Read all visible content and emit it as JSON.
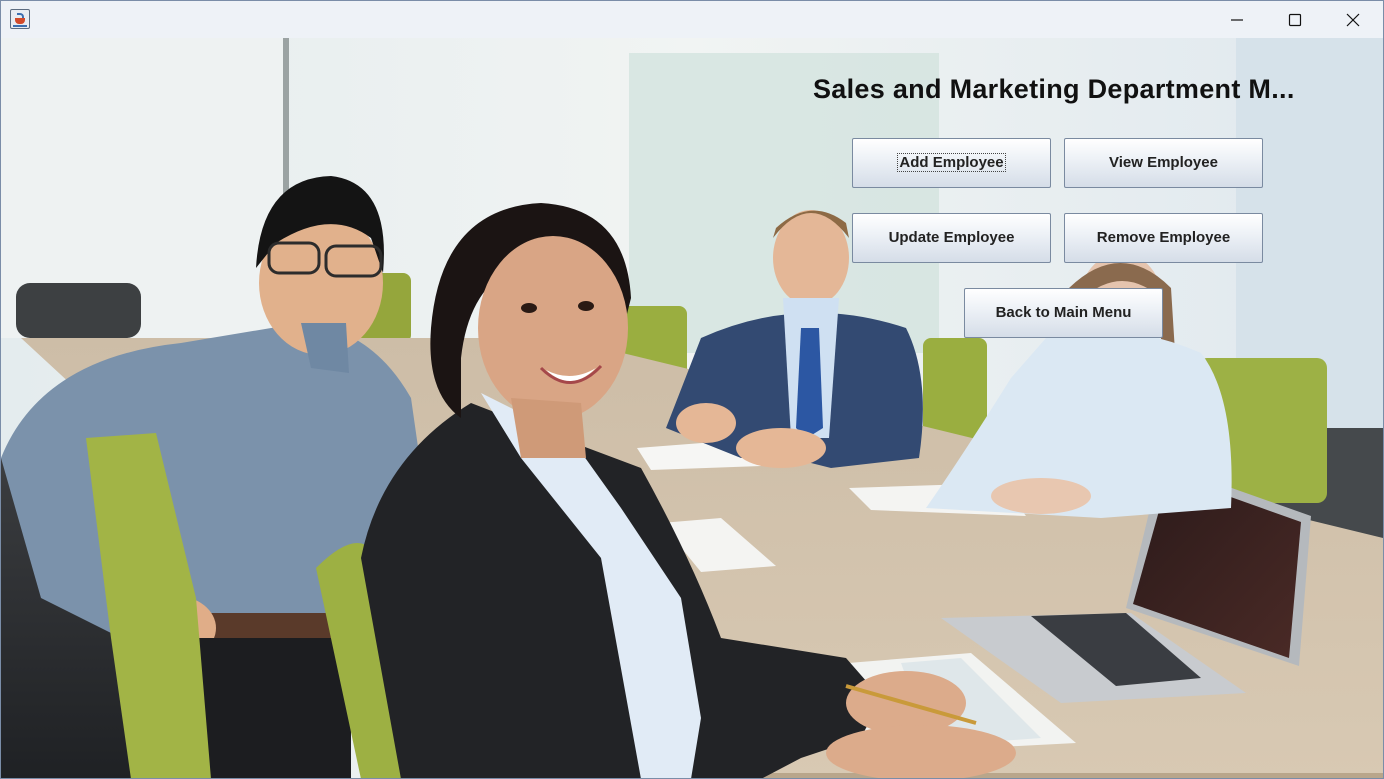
{
  "window": {
    "title": "",
    "controls": {
      "minimize_icon": "minimize-icon",
      "maximize_icon": "maximize-icon",
      "close_icon": "close-icon"
    }
  },
  "main": {
    "heading": "Sales and Marketing Department M...",
    "buttons": {
      "add_employee": "Add Employee",
      "view_employee": "View Employee",
      "update_employee": "Update Employee",
      "remove_employee": "Remove Employee",
      "back_to_main_menu": "Back to Main Menu"
    },
    "focused_button": "add_employee"
  },
  "background": {
    "description_icon": "office-meeting-photo",
    "accent_colors": {
      "button_border": "#7a8aa0",
      "chair_green": "#9aad3c",
      "wall": "#e9eff1"
    }
  }
}
